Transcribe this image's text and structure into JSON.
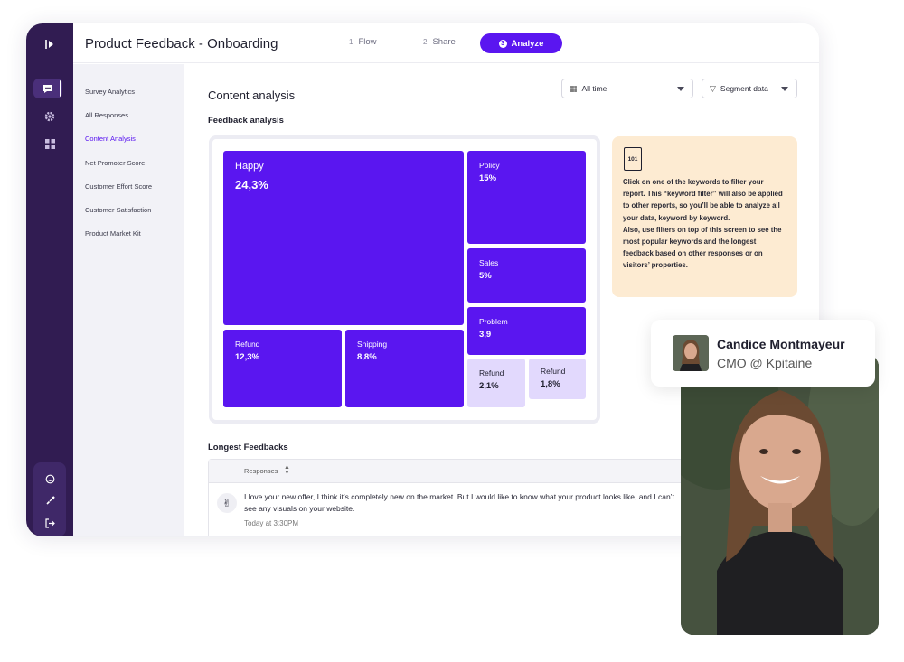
{
  "header": {
    "title": "Product Feedback - Onboarding",
    "steps": [
      {
        "num": "1",
        "label": "Flow"
      },
      {
        "num": "2",
        "label": "Share"
      },
      {
        "num": "3",
        "label": "Analyze"
      }
    ]
  },
  "sidebar": {
    "items": [
      {
        "label": "Survey Analytics"
      },
      {
        "label": "All Responses"
      },
      {
        "label": "Content Analysis"
      },
      {
        "label": "Net Promoter Score"
      },
      {
        "label": "Customer Effort Score"
      },
      {
        "label": "Customer Satisfaction"
      },
      {
        "label": "Product Market Kit"
      }
    ]
  },
  "main": {
    "title": "Content analysis",
    "filters": {
      "time": "All time",
      "segment": "Segment data"
    },
    "feedback_section_title": "Feedback analysis",
    "longest_title": "Longest Feedbacks"
  },
  "treemap": {
    "tiles": [
      {
        "label": "Happy",
        "value": "24,3%"
      },
      {
        "label": "Policy",
        "value": "15%"
      },
      {
        "label": "Sales",
        "value": "5%"
      },
      {
        "label": "Problem",
        "value": "3,9"
      },
      {
        "label": "Refund",
        "value": "12,3%"
      },
      {
        "label": "Shipping",
        "value": "8,8%"
      },
      {
        "label": "Refund",
        "value": "2,1%"
      },
      {
        "label": "Refund",
        "value": "1,8%"
      }
    ]
  },
  "info": {
    "icon_label": "101",
    "text": "Click on one of the keywords to filter your report. This “keyword filter” will also be applied to other reports, so you’ll be able to analyze all your data, keyword by keyword.\nAlso, use filters on top of this screen to see the most popular keywords and the longest feedback based on other responses or on visitors’ properties."
  },
  "table": {
    "column": "Responses",
    "rows": [
      {
        "emoji": "✌",
        "text": "I love your new offer, I think it’s completely new on the market. But I would like to know what your product looks like, and I can’t see any visuals on your website.",
        "time": "Today at 3:30PM"
      }
    ]
  },
  "person": {
    "name": "Candice Montmayeur",
    "role": "CMO @ Kpitaine"
  },
  "colors": {
    "accent": "#5a16f0",
    "rail": "#311c52",
    "tile_light": "#e2d9fd",
    "info_bg": "#fdebd2"
  }
}
